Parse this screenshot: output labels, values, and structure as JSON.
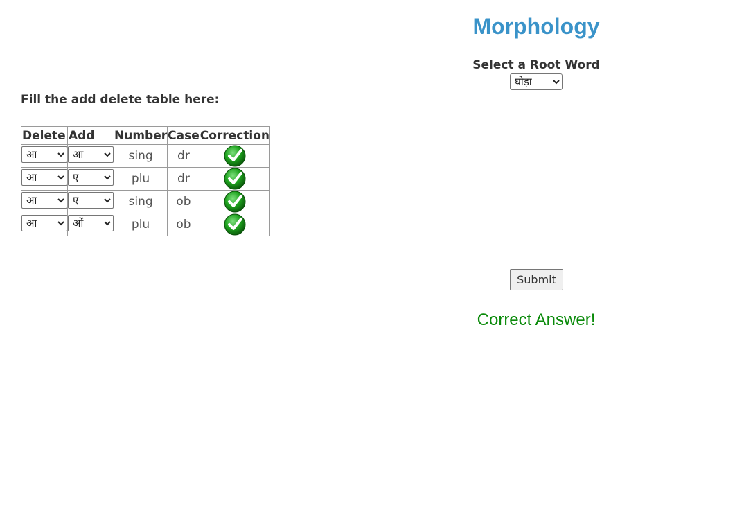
{
  "title": "Morphology",
  "root": {
    "label": "Select a Root Word",
    "selected": "घोड़ा"
  },
  "instruction": "Fill the add delete table here:",
  "table": {
    "headers": [
      "Delete",
      "Add",
      "Number",
      "Case",
      "Correction"
    ],
    "rows": [
      {
        "delete": "आ",
        "add": "आ",
        "number": "sing",
        "case": "dr",
        "correct": true
      },
      {
        "delete": "आ",
        "add": "ए",
        "number": "plu",
        "case": "dr",
        "correct": true
      },
      {
        "delete": "आ",
        "add": "ए",
        "number": "sing",
        "case": "ob",
        "correct": true
      },
      {
        "delete": "आ",
        "add": "ओं",
        "number": "plu",
        "case": "ob",
        "correct": true
      }
    ]
  },
  "submit_label": "Submit",
  "result_text": "Correct Answer!",
  "icons": {
    "correction": "green-check-icon"
  },
  "colors": {
    "title": "#3a93c9",
    "result": "#0a8a0a"
  }
}
